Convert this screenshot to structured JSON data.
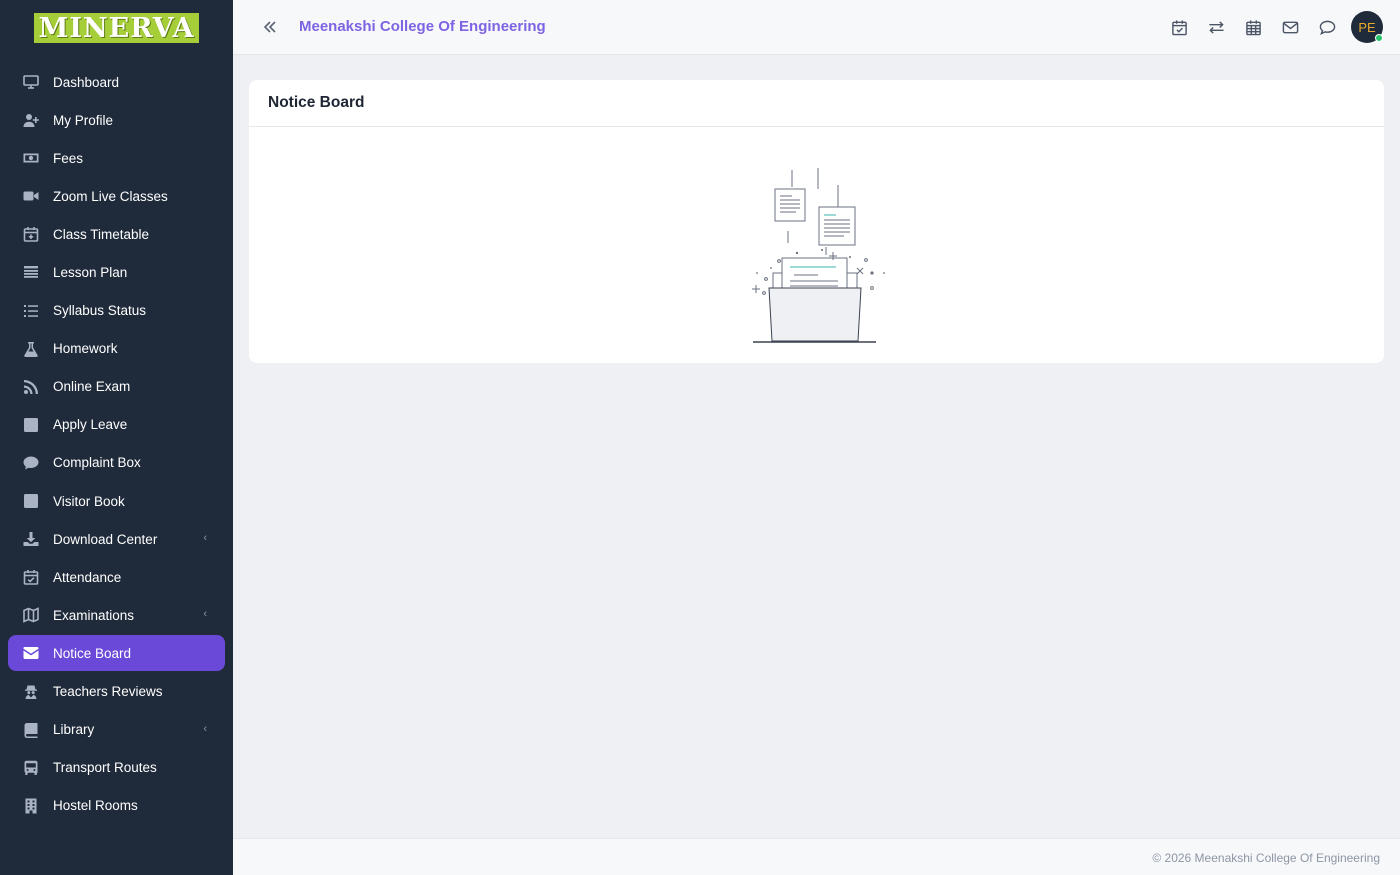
{
  "app": {
    "logo_text": "MINERVA",
    "college_name": "Meenakshi College Of Engineering",
    "avatar_initials": "PE"
  },
  "sidebar": {
    "items": [
      {
        "label": "Dashboard",
        "icon": "monitor-icon"
      },
      {
        "label": "My Profile",
        "icon": "user-plus-icon"
      },
      {
        "label": "Fees",
        "icon": "money-bill-icon"
      },
      {
        "label": "Zoom Live Classes",
        "icon": "video-icon"
      },
      {
        "label": "Class Timetable",
        "icon": "calendar-plus-icon"
      },
      {
        "label": "Lesson Plan",
        "icon": "list-icon"
      },
      {
        "label": "Syllabus Status",
        "icon": "list-ol-icon"
      },
      {
        "label": "Homework",
        "icon": "flask-icon"
      },
      {
        "label": "Online Exam",
        "icon": "rss-icon"
      },
      {
        "label": "Apply Leave",
        "icon": "check-square-icon"
      },
      {
        "label": "Complaint Box",
        "icon": "comment-icon"
      },
      {
        "label": "Visitor Book",
        "icon": "check-square-icon"
      },
      {
        "label": "Download Center",
        "icon": "download-icon",
        "has_submenu": true
      },
      {
        "label": "Attendance",
        "icon": "calendar-check-icon"
      },
      {
        "label": "Examinations",
        "icon": "map-icon",
        "has_submenu": true
      },
      {
        "label": "Notice Board",
        "icon": "envelope-icon",
        "active": true
      },
      {
        "label": "Teachers Reviews",
        "icon": "user-secret-icon"
      },
      {
        "label": "Library",
        "icon": "book-icon",
        "has_submenu": true
      },
      {
        "label": "Transport Routes",
        "icon": "bus-icon"
      },
      {
        "label": "Hostel Rooms",
        "icon": "building-icon"
      }
    ]
  },
  "topbar": {
    "icons": [
      "calendar-check-icon",
      "exchange-icon",
      "calendar-icon",
      "envelope-icon",
      "chat-icon"
    ]
  },
  "main": {
    "card_title": "Notice Board"
  },
  "footer": {
    "text": "© 2026 Meenakshi College Of Engineering"
  },
  "colors": {
    "sidebar_bg": "#1f2a3a",
    "active_item": "#6a49d8",
    "accent_title": "#7e63e3",
    "logo_bg": "#a6ce39"
  }
}
